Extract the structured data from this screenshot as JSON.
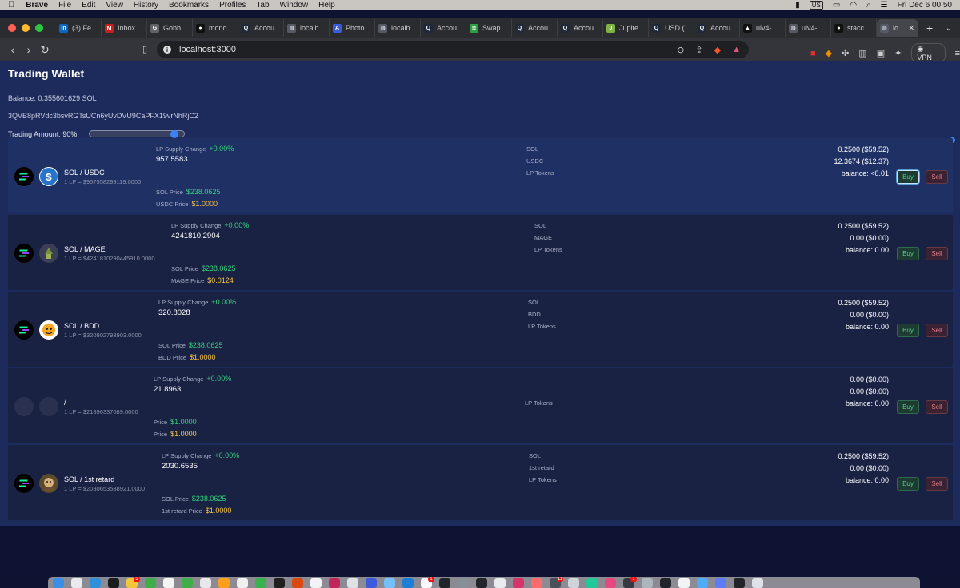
{
  "menubar": {
    "items": [
      "Brave",
      "File",
      "Edit",
      "View",
      "History",
      "Bookmarks",
      "Profiles",
      "Tab",
      "Window",
      "Help"
    ],
    "input_source": "US",
    "clock": "Fri Dec 6  00:50"
  },
  "tabs": [
    {
      "title": "(3) Fe",
      "fav": "in",
      "color": "#0a66c2"
    },
    {
      "title": "Inbox",
      "fav": "M",
      "color": "#c5221f"
    },
    {
      "title": "Gobb",
      "fav": "G",
      "color": "#5f6368"
    },
    {
      "title": "mono",
      "fav": "●",
      "color": "#111111"
    },
    {
      "title": "Accou",
      "fav": "Q",
      "color": "#1e2a3a"
    },
    {
      "title": "localh",
      "fav": "◍",
      "color": "#555a66"
    },
    {
      "title": "Photo",
      "fav": "A",
      "color": "#3b5bdb"
    },
    {
      "title": "localh",
      "fav": "◍",
      "color": "#555a66"
    },
    {
      "title": "Accou",
      "fav": "Q",
      "color": "#1e2a3a"
    },
    {
      "title": "Swap",
      "fav": "≋",
      "color": "#2f9e44"
    },
    {
      "title": "Accou",
      "fav": "Q",
      "color": "#1e2a3a"
    },
    {
      "title": "Accou",
      "fav": "Q",
      "color": "#1e2a3a"
    },
    {
      "title": "Jupite",
      "fav": "J",
      "color": "#7cb342"
    },
    {
      "title": "USD (",
      "fav": "Q",
      "color": "#1e2a3a"
    },
    {
      "title": "Accou",
      "fav": "Q",
      "color": "#1e2a3a"
    },
    {
      "title": "uiv4-",
      "fav": "▲",
      "color": "#111111"
    },
    {
      "title": "uiv4-",
      "fav": "◍",
      "color": "#555a66"
    },
    {
      "title": "stacc",
      "fav": "●",
      "color": "#111111"
    },
    {
      "title": "lo",
      "fav": "◍",
      "color": "#555a66"
    }
  ],
  "address": {
    "url": "localhost:3000",
    "vpn": "VPN"
  },
  "page": {
    "title": "Trading Wallet",
    "balance": "Balance: 0.355601629 SOL",
    "wallet": "3QVB8pRVdc3bsvRGTsUCn6yUvDVU9CaPFX19vrNhRjC2",
    "amount_label": "Trading Amount: 90%",
    "amount_pct": 90
  },
  "rows": [
    {
      "pair": "SOL / USDC",
      "lp_value": "1 LP = $957558299119.0000",
      "lp_change_label": "LP Supply Change",
      "lp_change": "+0.00%",
      "lp_supply": "957.5583",
      "price1_label": "SOL Price",
      "price1": "$238.0625",
      "price2_label": "USDC Price",
      "price2": "$1.0000",
      "mid1": "SOL",
      "mid2": "USDC",
      "mid3": "LP Tokens",
      "amt1": "0.2500 ($59.52)",
      "amt2": "12.3674 ($12.37)",
      "balance": "balance: <0.01",
      "buy": "Buy",
      "sell": "Sell"
    },
    {
      "pair": "SOL / MAGE",
      "lp_value": "1 LP = $4241810290445910.0000",
      "lp_change_label": "LP Supply Change",
      "lp_change": "+0.00%",
      "lp_supply": "4241810.2904",
      "price1_label": "SOL Price",
      "price1": "$238.0625",
      "price2_label": "MAGE Price",
      "price2": "$0.0124",
      "mid1": "SOL",
      "mid2": "MAGE",
      "mid3": "LP Tokens",
      "amt1": "0.2500 ($59.52)",
      "amt2": "0.00 ($0.00)",
      "balance": "balance: 0.00",
      "buy": "Buy",
      "sell": "Sell"
    },
    {
      "pair": "SOL / BDD",
      "lp_value": "1 LP = $320802793903.0000",
      "lp_change_label": "LP Supply Change",
      "lp_change": "+0.00%",
      "lp_supply": "320.8028",
      "price1_label": "SOL Price",
      "price1": "$238.0625",
      "price2_label": "BDD Price",
      "price2": "$1.0000",
      "mid1": "SOL",
      "mid2": "BDD",
      "mid3": "LP Tokens",
      "amt1": "0.2500 ($59.52)",
      "amt2": "0.00 ($0.00)",
      "balance": "balance: 0.00",
      "buy": "Buy",
      "sell": "Sell"
    },
    {
      "pair": "/",
      "lp_value": "1 LP = $21896337089.0000",
      "lp_change_label": "LP Supply Change",
      "lp_change": "+0.00%",
      "lp_supply": "21.8963",
      "price1_label": "Price",
      "price1": "$1.0000",
      "price2_label": "Price",
      "price2": "$1.0000",
      "mid1": "",
      "mid2": "",
      "mid3": "LP Tokens",
      "amt1": "0.00 ($0.00)",
      "amt2": "0.00 ($0.00)",
      "balance": "balance: 0.00",
      "buy": "Buy",
      "sell": "Sell"
    },
    {
      "pair": "SOL / 1st retard",
      "lp_value": "1 LP = $2030653538921.0000",
      "lp_change_label": "LP Supply Change",
      "lp_change": "+0.00%",
      "lp_supply": "2030.6535",
      "price1_label": "SOL Price",
      "price1": "$238.0625",
      "price2_label": "1st retard Price",
      "price2": "$1.0000",
      "mid1": "SOL",
      "mid2": "1st retard",
      "mid3": "LP Tokens",
      "amt1": "0.2500 ($59.52)",
      "amt2": "0.00 ($0.00)",
      "balance": "balance: 0.00",
      "buy": "Buy",
      "sell": "Sell"
    }
  ],
  "dock": {
    "badges": [
      "3",
      "1",
      "11",
      "1"
    ]
  }
}
